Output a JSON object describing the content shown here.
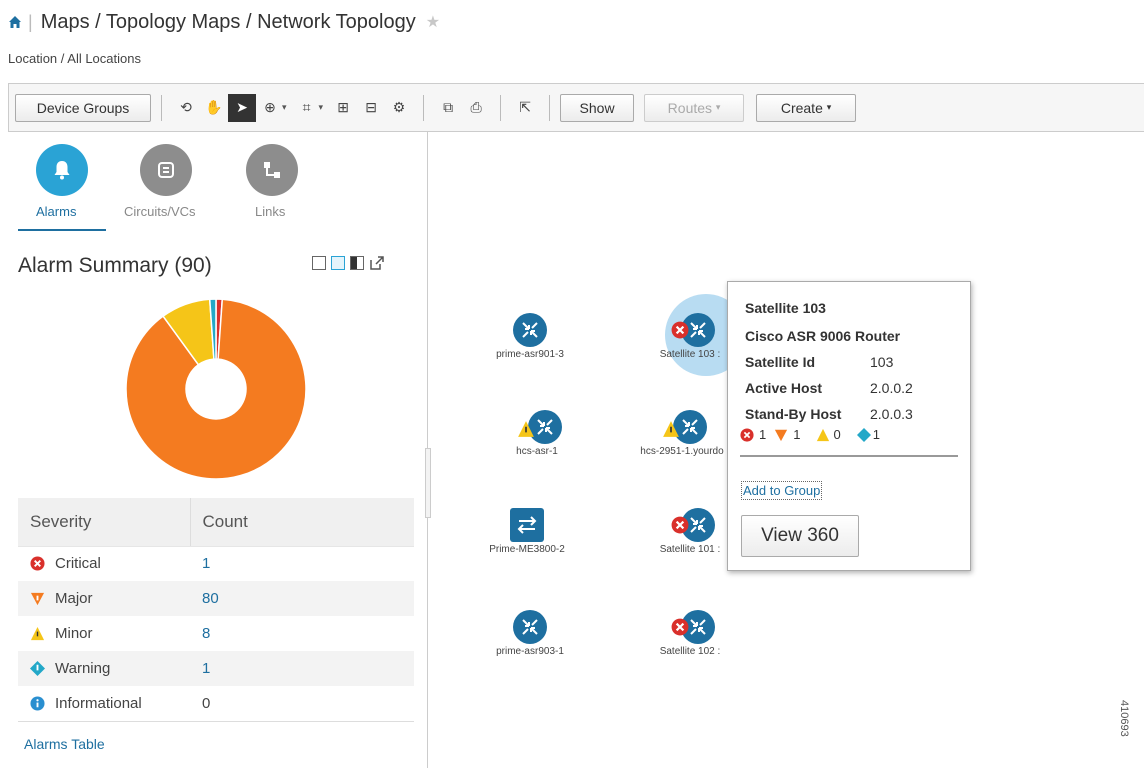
{
  "header": {
    "breadcrumb": "Maps / Topology Maps / Network Topology",
    "location": "Location / All Locations"
  },
  "toolbar": {
    "device_groups": "Device Groups",
    "show": "Show",
    "routes": "Routes",
    "create": "Create"
  },
  "tabs": [
    {
      "label": "Alarms",
      "icon": "bell-icon"
    },
    {
      "label": "Circuits/VCs",
      "icon": "circuit-icon"
    },
    {
      "label": "Links",
      "icon": "link-icon"
    }
  ],
  "alarm_summary": {
    "title": "Alarm Summary (90)",
    "col_severity": "Severity",
    "col_count": "Count",
    "rows": [
      {
        "severity": "Critical",
        "count": "1",
        "color": "#d9302b"
      },
      {
        "severity": "Major",
        "count": "80",
        "color": "#f47b20"
      },
      {
        "severity": "Minor",
        "count": "8",
        "color": "#f5c518"
      },
      {
        "severity": "Warning",
        "count": "1",
        "color": "#23a8c8"
      },
      {
        "severity": "Informational",
        "count": "0",
        "color": "#2a8fd0"
      }
    ],
    "link": "Alarms Table"
  },
  "chart_data": {
    "type": "pie",
    "categories": [
      "Critical",
      "Major",
      "Minor",
      "Warning",
      "Informational"
    ],
    "values": [
      1,
      80,
      8,
      1,
      0
    ],
    "colors": [
      "#d9302b",
      "#f47b20",
      "#f5c518",
      "#23a8c8",
      "#2a8fd0"
    ]
  },
  "map": {
    "nodes": [
      {
        "label": "prime-asr901-3"
      },
      {
        "label": "Satellite 103 :"
      },
      {
        "label": "hcs-asr-1"
      },
      {
        "label": "hcs-2951-1.yourdo"
      },
      {
        "label": "Prime-ME3800-2"
      },
      {
        "label": "Satellite 101 :"
      },
      {
        "label": "prime-asr903-1"
      },
      {
        "label": "Satellite 102 :"
      }
    ]
  },
  "popup": {
    "title": "Satellite 103",
    "device_type": "Cisco ASR 9006 Router",
    "fields": [
      {
        "label": "Satellite Id",
        "value": "103"
      },
      {
        "label": "Active Host",
        "value": "2.0.0.2"
      },
      {
        "label": "Stand-By Host",
        "value": "2.0.0.3"
      }
    ],
    "alarm_counts": [
      "1",
      "1",
      "0",
      "1"
    ],
    "add_to_group": "Add to Group",
    "view360": "View 360"
  },
  "figure_id": "410693"
}
